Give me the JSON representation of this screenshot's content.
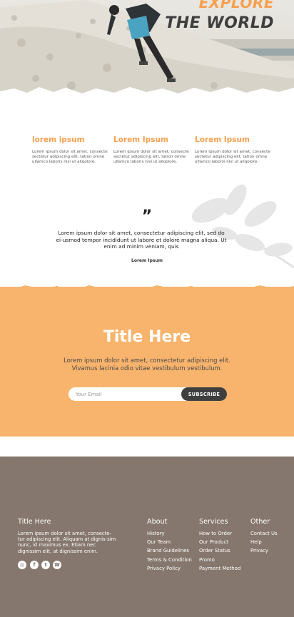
{
  "hero": {
    "title_line1": "EXPLORE",
    "title_line2": "THE WORLD"
  },
  "features": [
    {
      "title": "lorem ipsum",
      "text": "Lorem ipsum dolor sit amet, consecte sectetur adipiscing elit, tation omne ullamco laboris nisi ut aliqolore."
    },
    {
      "title": "Lorem Ipsum",
      "text": "Lorem ipsum dolor sit amet, consecte sectetur adipiscing elit, tation omne ullamco laboris nisi ut aliqolore."
    },
    {
      "title": "Lorem Ipsum",
      "text": "Lorem ipsum dolor sit amet, consecte sectetur adipiscing elit, tation omne ullamco laboris nisi ut aliqolore."
    }
  ],
  "quote": {
    "mark": "”",
    "text": "Lorem ipsum dolor sit amet, consectetur adipiscing elit, sed do ei-usmod tempor incididunt ut labore et dolore magna aliqua. Ut enim ad minim veniam, quis",
    "author": "Lorem Ipsum"
  },
  "cta": {
    "title": "Title Here",
    "subtitle": "Lorem ipsum dolor sit amet, consectetur adipiscing elit. Vivamus lacinia odio vitae vestibulum vestibulum.",
    "email_placeholder": "Your Email",
    "subscribe_label": "SUBSCRIBE"
  },
  "footer": {
    "about_brand": {
      "title": "Title Here",
      "text": "Lorem ipsum dolor sit amet, consecte-tur adipiscing elit. Aliquam at dignis-sim nunc, id maximus ex. Etiam nec dignissim elit, at dignissim enim."
    },
    "social": [
      {
        "icon": "instagram-icon",
        "glyph": "◎"
      },
      {
        "icon": "facebook-icon",
        "glyph": "f"
      },
      {
        "icon": "twitter-icon",
        "glyph": "t"
      },
      {
        "icon": "whatsapp-icon",
        "glyph": "☎"
      }
    ],
    "columns": [
      {
        "title": "About",
        "items": [
          "History",
          "Our Team",
          "Brand Guidelines",
          "Terms & Condition",
          "Privacy Policy"
        ]
      },
      {
        "title": "Services",
        "items": [
          "How to Order",
          "Our Product",
          "Order Status",
          "Promo",
          "Payment Method"
        ]
      },
      {
        "title": "Other",
        "items": [
          "Contact Us",
          "Help",
          "Privacy"
        ]
      }
    ]
  },
  "colors": {
    "accent": "#f6a04f",
    "orange_band": "#f8b46c",
    "footer_bg": "#85776d",
    "button_dark": "#3f3f3f"
  }
}
